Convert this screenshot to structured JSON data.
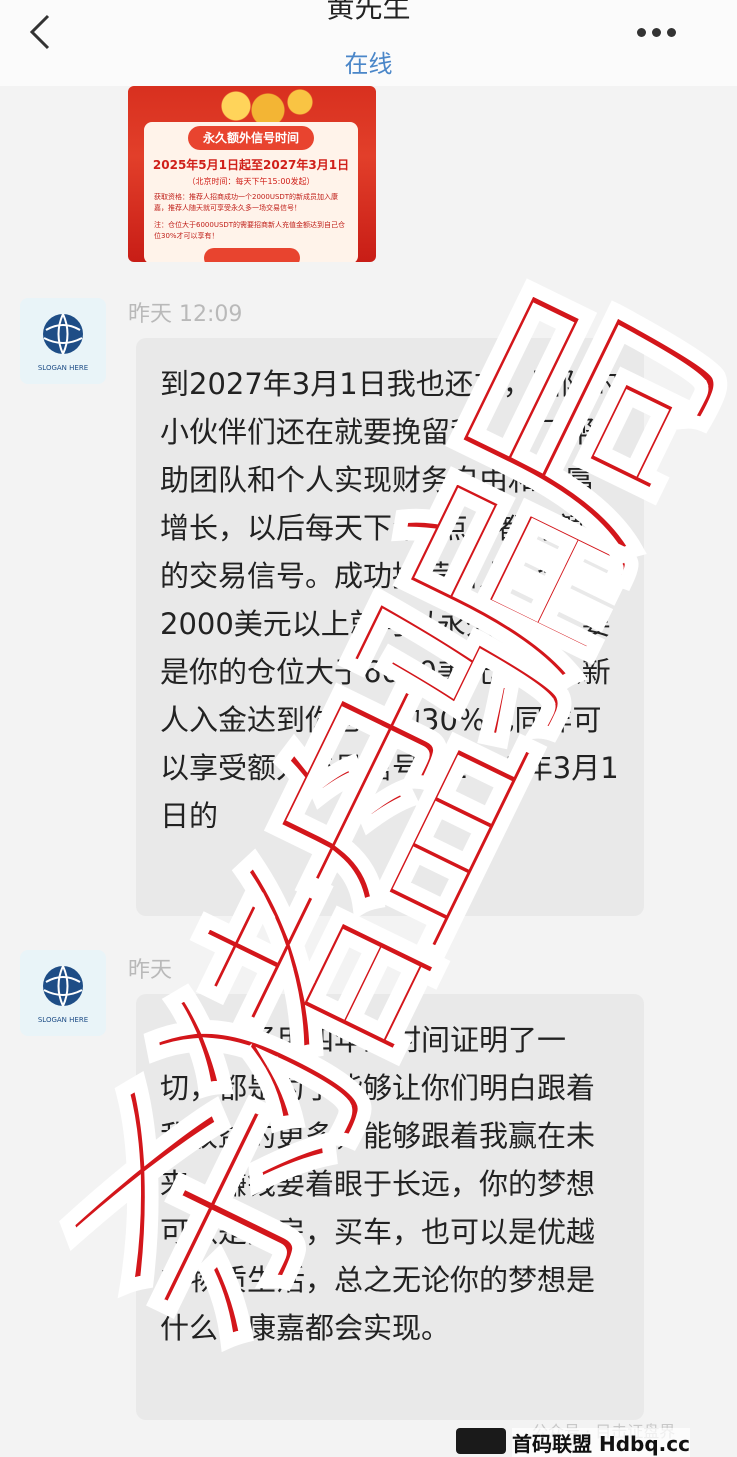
{
  "header": {
    "title": "黄先生",
    "status": "在线",
    "back_icon": "chevron-left-icon",
    "more_icon": "more-horizontal-icon"
  },
  "poster": {
    "ribbon": "永久额外信号时间",
    "dates": "2025年5月1日起至2027年3月1日",
    "beijing_time": "（北京时间：每天下午15:00发起）",
    "rule1": "获取资格：推荐人招商成功一个2000USDT的新成员加入康嘉，推荐人随天就可享受永久多一场交易信号！",
    "rule2": "注：仓位大于6000USDT的需要招商新人充值金额达到自己仓位30%才可以享有！"
  },
  "messages": [
    {
      "time": "昨天 12:09",
      "text": "到2027年3月1日我也还在，团队的小伙伴们还在就要挽留我，为了帮助团队和个人实现财务自由和财富增长，以后每天下午3点，都有额外的交易信号。成功推荐新人入金2000美元以上就可以永久享受，要是你的仓位大于6000美元，那么新人入金达到你仓位的30%也同样可以享受额外交易信号至2027年3月1日的"
    },
    {
      "time": "昨天",
      "text": "康嘉已经用四年的时间证明了一切，都是为了能够让你们明白跟着我收益的更多，能够跟着我赢在未来，赚钱要着眼于长远，你的梦想可以是买房，买车，也可以是优越的物质生活，总之无论你的梦想是什么在康嘉都会实现。"
    }
  ],
  "stamp": {
    "text": "杀猪盘骗局",
    "color": "#d3161b"
  },
  "watermark": {
    "top": "公众号 · 目击证盘界",
    "bottom": "首码联盟 Hdbq.cc"
  }
}
